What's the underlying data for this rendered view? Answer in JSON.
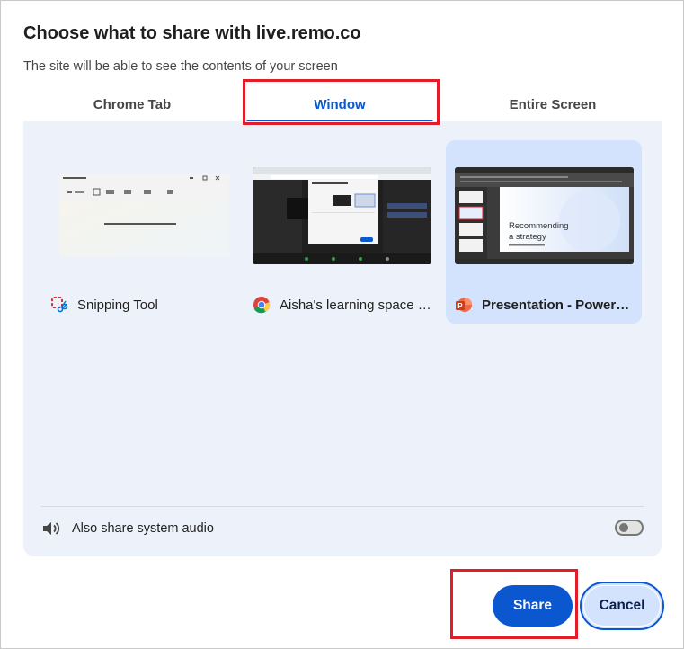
{
  "dialog": {
    "title": "Choose what to share with live.remo.co",
    "subtitle": "The site will be able to see the contents of your screen"
  },
  "tabs": [
    {
      "label": "Chrome Tab",
      "active": false
    },
    {
      "label": "Window",
      "active": true
    },
    {
      "label": "Entire Screen",
      "active": false
    }
  ],
  "windows": [
    {
      "name": "Snipping Tool",
      "icon": "snipping-tool-icon",
      "selected": false
    },
    {
      "name": "Aisha's learning space | Remo - Google Chrome",
      "icon": "chrome-icon",
      "selected": false
    },
    {
      "name": "Presentation - PowerPoint",
      "icon": "powerpoint-icon",
      "selected": true
    }
  ],
  "thumbnails": {
    "slide_text_line1": "Recommending",
    "slide_text_line2": "a strategy"
  },
  "audio": {
    "label": "Also share system audio",
    "enabled": false
  },
  "buttons": {
    "share": "Share",
    "cancel": "Cancel"
  },
  "colors": {
    "accent": "#0b57d0",
    "panel": "#edf2fa",
    "selected": "#d3e3fd",
    "annotation": "#e11d2a"
  }
}
